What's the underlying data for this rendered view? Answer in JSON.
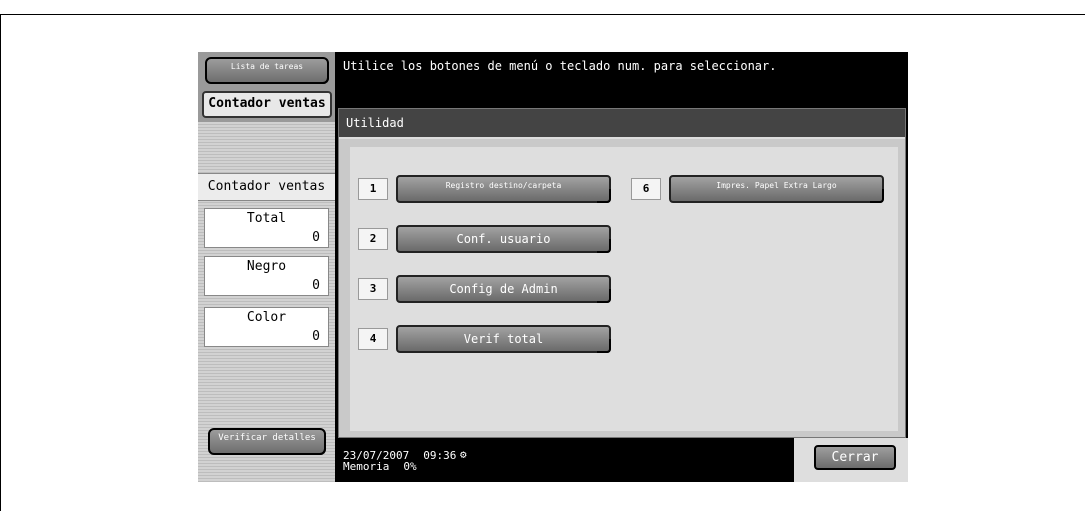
{
  "sidebar": {
    "lista_label": "Lista de tareas",
    "contador_tab": "Contador ventas",
    "section_label": "Contador ventas",
    "counters": [
      {
        "label": "Total",
        "value": "0"
      },
      {
        "label": "Negro",
        "value": "0"
      },
      {
        "label": "Color",
        "value": "0"
      }
    ],
    "verificar_label": "Verificar detalles"
  },
  "message": "Utilice los botones de menú o teclado num. para seleccionar.",
  "panel": {
    "title": "Utilidad",
    "items": [
      {
        "num": "1",
        "label": "Registro destino/carpeta"
      },
      {
        "num": "2",
        "label": "Conf. usuario"
      },
      {
        "num": "3",
        "label": "Config de Admin"
      },
      {
        "num": "4",
        "label": "Verif total"
      },
      {
        "num": "6",
        "label": "Impres. Papel Extra Largo"
      }
    ]
  },
  "status": {
    "date": "23/07/2007",
    "time": "09:36",
    "memory_label": "Memoria",
    "memory_value": "0%"
  },
  "close_label": "Cerrar"
}
